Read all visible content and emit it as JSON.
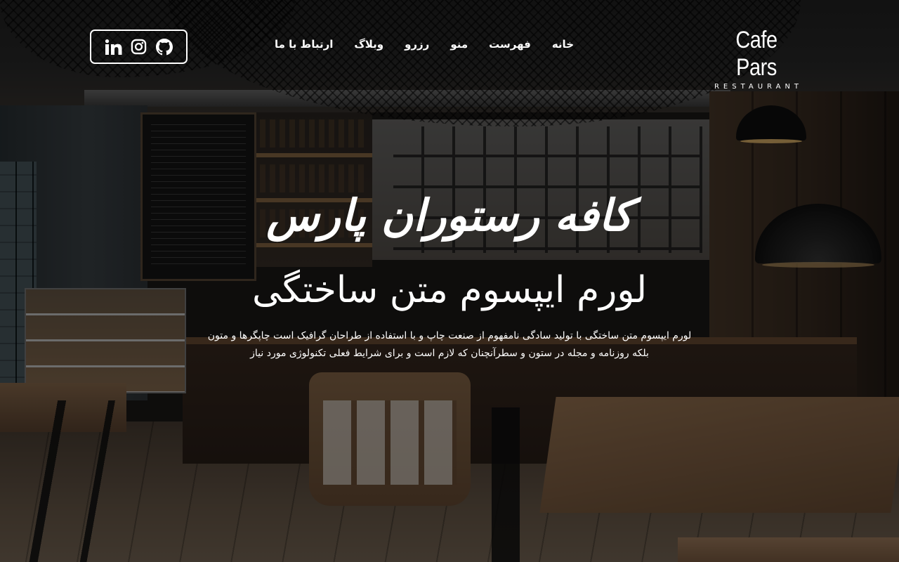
{
  "brand": {
    "name": "Cafe Pars",
    "subtitle": "RESTAURANT"
  },
  "nav": {
    "items": [
      {
        "label": "خانه"
      },
      {
        "label": "فهرست"
      },
      {
        "label": "منو"
      },
      {
        "label": "رزرو"
      },
      {
        "label": "وبلاگ"
      },
      {
        "label": "ارتباط با ما"
      }
    ]
  },
  "social": {
    "icons": [
      "linkedin-icon",
      "instagram-icon",
      "github-icon"
    ]
  },
  "hero": {
    "calligraphy": "کافه رستوران پارس",
    "title": "لورم ایپسوم متن ساختگی",
    "description_line1": "لورم ایپسوم متن ساختگی با تولید سادگی نامفهوم از صنعت چاپ و با استفاده از طراحان گرافیک است چاپگرها و متون",
    "description_line2": "بلکه روزنامه و مجله در ستون و سطرآنچنان که لازم است و برای شرایط فعلی تکنولوژی مورد نیاز"
  },
  "colors": {
    "text": "#ffffff",
    "overlay": "rgba(0,0,0,0.48)"
  }
}
